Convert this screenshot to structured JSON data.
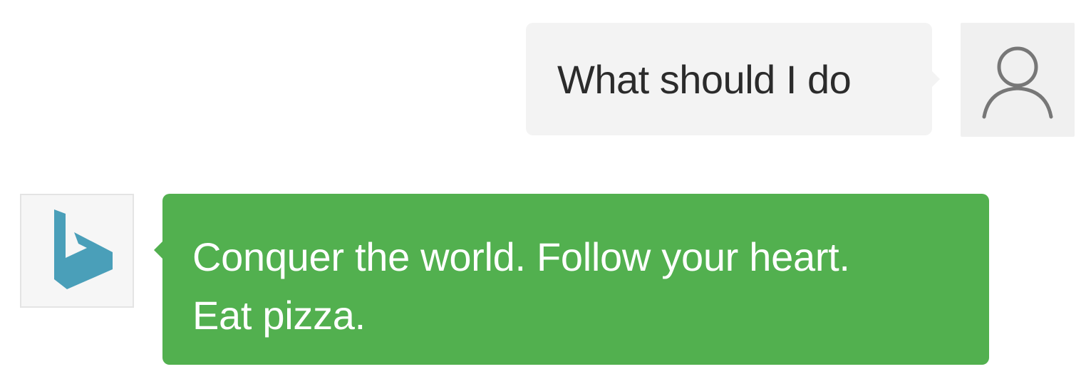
{
  "conversation": {
    "messages": [
      {
        "sender": "user",
        "avatar_icon": "person-icon",
        "text": "What should I do",
        "bubble_color": "#f3f3f3"
      },
      {
        "sender": "bot",
        "avatar_icon": "bing-logo-icon",
        "text": "Conquer the world. Follow your heart. Eat pizza.",
        "bubble_color": "#52b04f"
      }
    ]
  },
  "colors": {
    "bot_bubble": "#52b04f",
    "user_bubble": "#f3f3f3",
    "bing_logo": "#4a9fb9",
    "person_icon": "#777777"
  }
}
